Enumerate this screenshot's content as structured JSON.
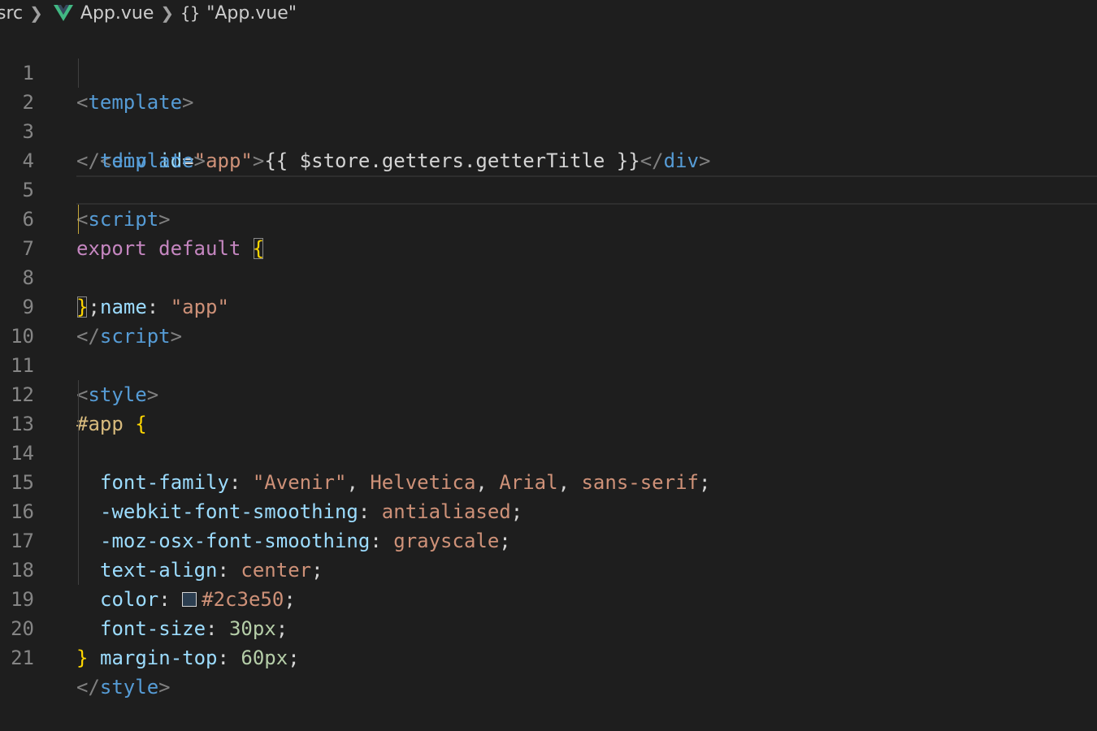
{
  "breadcrumb": {
    "folder": "src",
    "file": "App.vue",
    "symbol_icon": "{}",
    "symbol": "\"App.vue\""
  },
  "lines": {
    "1": {
      "n": "1",
      "a": "<",
      "b": "template",
      "c": ">"
    },
    "2": {
      "n": "2",
      "a": "<",
      "b": "div",
      "c": " id",
      "d": "=",
      "e": "\"app\"",
      "f": ">",
      "g": "{{ $store.getters.getterTitle }}",
      "h": "</",
      "i": "div",
      "j": ">"
    },
    "3": {
      "n": "3",
      "a": "</",
      "b": "template",
      "c": ">"
    },
    "4": {
      "n": "4"
    },
    "5": {
      "n": "5",
      "a": "<",
      "b": "script",
      "c": ">"
    },
    "6": {
      "n": "6",
      "a": "export default ",
      "b": "{"
    },
    "7": {
      "n": "7",
      "a": "name",
      "b": ": ",
      "c": "\"app\""
    },
    "8": {
      "n": "8",
      "a": "}",
      "b": ";"
    },
    "9": {
      "n": "9",
      "a": "</",
      "b": "script",
      "c": ">"
    },
    "10": {
      "n": "10"
    },
    "11": {
      "n": "11",
      "a": "<",
      "b": "style",
      "c": ">"
    },
    "12": {
      "n": "12",
      "a": "#app ",
      "b": "{"
    },
    "13": {
      "n": "13",
      "a": "font-family",
      "b": ": ",
      "c": "\"Avenir\"",
      "d": ", ",
      "e": "Helvetica",
      "f": ", ",
      "g": "Arial",
      "h": ", ",
      "i": "sans-serif",
      "j": ";"
    },
    "14": {
      "n": "14",
      "a": "-webkit-font-smoothing",
      "b": ": ",
      "c": "antialiased",
      "d": ";"
    },
    "15": {
      "n": "15",
      "a": "-moz-osx-font-smoothing",
      "b": ": ",
      "c": "grayscale",
      "d": ";"
    },
    "16": {
      "n": "16",
      "a": "text-align",
      "b": ": ",
      "c": "center",
      "d": ";"
    },
    "17": {
      "n": "17",
      "a": "color",
      "b": ": ",
      "c": "#2c3e50",
      "d": ";",
      "swatch_color": "#2c3e50"
    },
    "18": {
      "n": "18",
      "a": "font-size",
      "b": ": ",
      "c": "30px",
      "d": ";"
    },
    "19": {
      "n": "19",
      "a": "margin-top",
      "b": ": ",
      "c": "60px",
      "d": ";"
    },
    "20": {
      "n": "20",
      "a": "}"
    },
    "21": {
      "n": "21",
      "a": "</",
      "b": "style",
      "c": ">"
    }
  },
  "colors": {
    "background": "#1e1e1e",
    "tag": "#569cd6",
    "attribute": "#9cdcfe",
    "string": "#ce9178",
    "keyword": "#c586c0",
    "bracket": "#ffd700",
    "number": "#b5cea8",
    "selector": "#d7ba7d"
  }
}
